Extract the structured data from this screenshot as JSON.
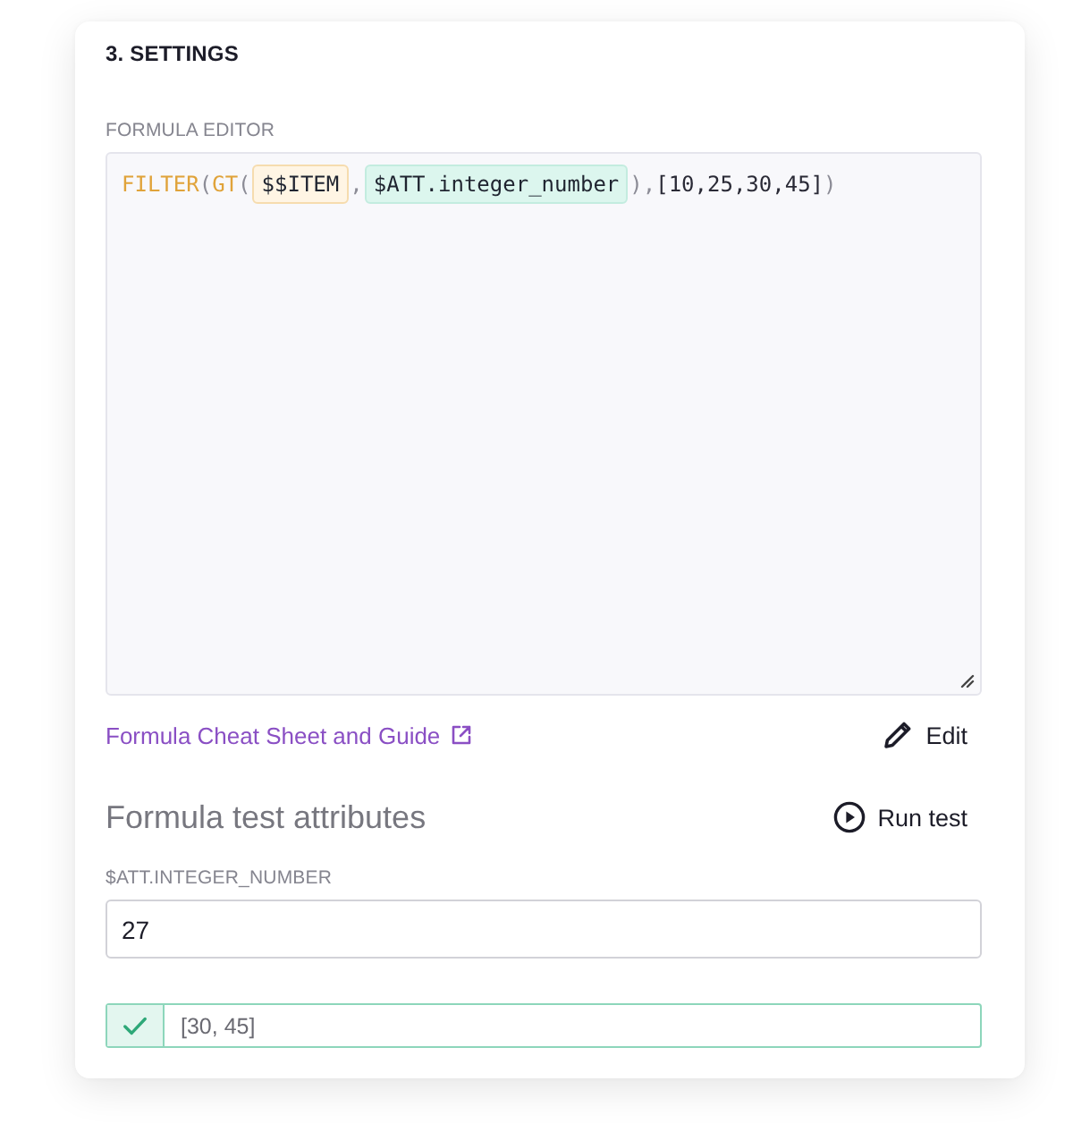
{
  "section": {
    "title": "3. SETTINGS"
  },
  "formula_editor": {
    "label": "FORMULA EDITOR",
    "tokens": [
      {
        "kind": "function",
        "text": "FILTER"
      },
      {
        "kind": "punct",
        "text": "("
      },
      {
        "kind": "function",
        "text": "GT"
      },
      {
        "kind": "punct",
        "text": "("
      },
      {
        "kind": "item",
        "text": "$$ITEM"
      },
      {
        "kind": "punct",
        "text": ","
      },
      {
        "kind": "attribute",
        "text": "$ATT.integer_number"
      },
      {
        "kind": "punct",
        "text": "),"
      },
      {
        "kind": "literal",
        "text": "[10,25,30,45]"
      },
      {
        "kind": "punct",
        "text": ")"
      }
    ]
  },
  "actions": {
    "guide_link": "Formula Cheat Sheet and Guide",
    "edit": "Edit"
  },
  "test": {
    "heading": "Formula test attributes",
    "run": "Run test",
    "fields": [
      {
        "label": "$ATT.INTEGER_NUMBER",
        "value": "27"
      }
    ]
  },
  "result": {
    "passed": true,
    "value": "[30, 45]"
  }
}
